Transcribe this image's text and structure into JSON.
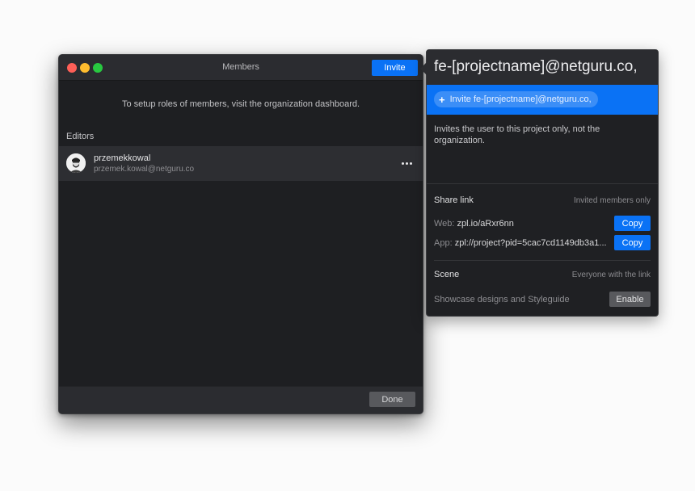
{
  "window": {
    "title": "Members",
    "invite_label": "Invite",
    "hint": "To setup roles of members, visit the organization dashboard.",
    "section_label": "Editors",
    "members": [
      {
        "username": "przemekkowal",
        "email": "przemek.kowal@netguru.co",
        "avatar_icon": "user-avatar",
        "more_icon": "ellipsis-icon"
      }
    ],
    "done_label": "Done"
  },
  "popover": {
    "input_value": "fe-[projectname]@netguru.co,",
    "suggestion_label": "Invite fe-[projectname]@netguru.co,",
    "suggestion_icon": "+",
    "description": "Invites the user to this project only, not the organization.",
    "share_link": {
      "label": "Share link",
      "access": "Invited members only",
      "web_key": "Web:",
      "web_value": "zpl.io/aRxr6nn",
      "app_key": "App:",
      "app_value": "zpl://project?pid=5cac7cd1149db3a1...",
      "copy_label": "Copy"
    },
    "scene": {
      "label": "Scene",
      "access": "Everyone with the link",
      "text": "Showcase designs and Styleguide",
      "enable_label": "Enable"
    }
  },
  "colors": {
    "accent": "#0a72f5",
    "window_bg": "#1e1f22",
    "titlebar_bg": "#2b2c30",
    "row_bg": "#2d2e32",
    "button_gray": "#58595d",
    "traffic_red": "#fe5f57",
    "traffic_yellow": "#febc2e",
    "traffic_green": "#28c840"
  }
}
